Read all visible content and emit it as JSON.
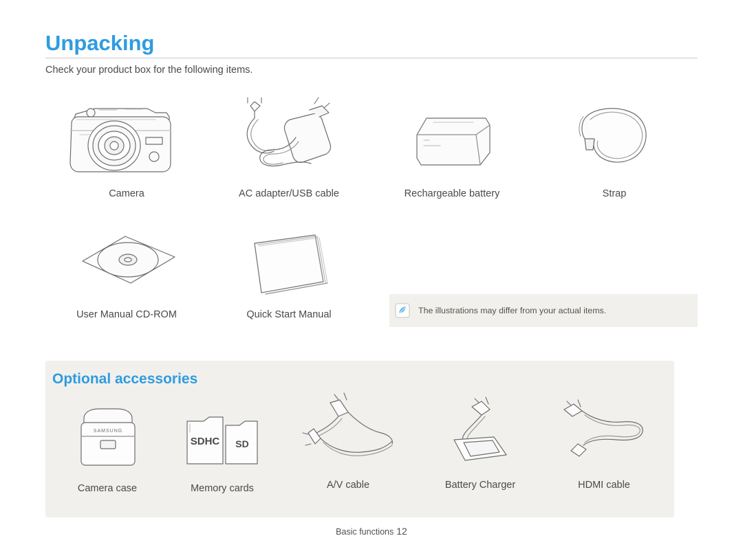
{
  "page": {
    "title": "Unpacking",
    "subtitle": "Check your product box for the following items.",
    "footer_label": "Basic functions",
    "footer_page": "12"
  },
  "box_items": [
    {
      "label": "Camera",
      "icon": "camera-illustration"
    },
    {
      "label": "AC adapter/USB cable",
      "icon": "ac-adapter-usb-cable-illustration"
    },
    {
      "label": "Rechargeable battery",
      "icon": "battery-illustration"
    },
    {
      "label": "Strap",
      "icon": "strap-illustration"
    },
    {
      "label": "User Manual CD-ROM",
      "icon": "cd-rom-illustration"
    },
    {
      "label": "Quick Start Manual",
      "icon": "quick-start-manual-illustration"
    }
  ],
  "note": {
    "icon": "note-icon",
    "text": "The illustrations may differ from your actual items."
  },
  "optional": {
    "heading": "Optional accessories",
    "items": [
      {
        "label": "Camera case",
        "icon": "camera-case-illustration"
      },
      {
        "label": "Memory cards",
        "icon": "memory-cards-illustration",
        "card_labels": [
          "SDHC",
          "SD"
        ]
      },
      {
        "label": "A/V cable",
        "icon": "av-cable-illustration"
      },
      {
        "label": "Battery Charger",
        "icon": "battery-charger-illustration"
      },
      {
        "label": "HDMI cable",
        "icon": "hdmi-cable-illustration"
      }
    ]
  },
  "colors": {
    "accent": "#2e9ce0",
    "text": "#4a4a4a",
    "panel": "#f2f0ec",
    "line": "#6e6e6e"
  }
}
